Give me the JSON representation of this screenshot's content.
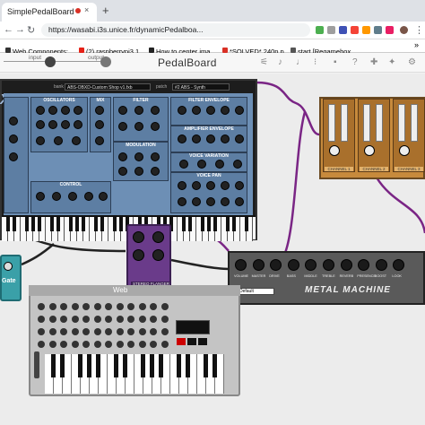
{
  "browser": {
    "tab_title": "SimplePedalBoard",
    "tab_close": "×",
    "new_tab": "+",
    "url": "https://wasabi.i3s.unice.fr/dynamicPedalboa...",
    "nav_back": "←",
    "nav_forward": "→",
    "nav_reload": "↻"
  },
  "bookmarks": [
    {
      "label": "Web Components:...",
      "color": "#333333"
    },
    {
      "label": "(2) raspberrypi3 1...",
      "color": "#e62117"
    },
    {
      "label": "How to center ima...",
      "color": "#222222"
    },
    {
      "label": "*SOLVED* 240p p...",
      "color": "#d93025"
    },
    {
      "label": "start [Regamebox...",
      "color": "#555555"
    }
  ],
  "pedalboard": {
    "title": "PedalBoard",
    "input_label": "input",
    "output_label": "output"
  },
  "synth": {
    "logo": "XD",
    "bank_label": "bank",
    "bank_value": "ABS-OBXD-Custom Shop v1.fxb",
    "patch_label": "patch",
    "patch_value": "#2 ABS - Synth",
    "sections": [
      "OSCILLATORS",
      "MIX",
      "FILTER",
      "FILTER ENVELOPE",
      "AMPLIFIER ENVELOPE",
      "MODULATION",
      "VOICE VARIATION",
      "VOICE PAN",
      "CONTROL"
    ]
  },
  "channel_pedal": {
    "channels": [
      "CHANNEL 1",
      "CHANNEL 2",
      "CHANNEL 3"
    ]
  },
  "flanger": {
    "label": "STEREO FLANGER"
  },
  "metal_machine": {
    "title": "METAL MACHINE",
    "preset": "Default",
    "knobs": [
      "VOLUME",
      "MASTER",
      "DRIVE",
      "BASS",
      "MIDDLE",
      "TREBLE",
      "REVERB",
      "PRESENCE",
      "BOOST",
      "LOOK"
    ]
  },
  "web_synth": {
    "title": "Web"
  },
  "gate": {
    "label": "Gate"
  }
}
